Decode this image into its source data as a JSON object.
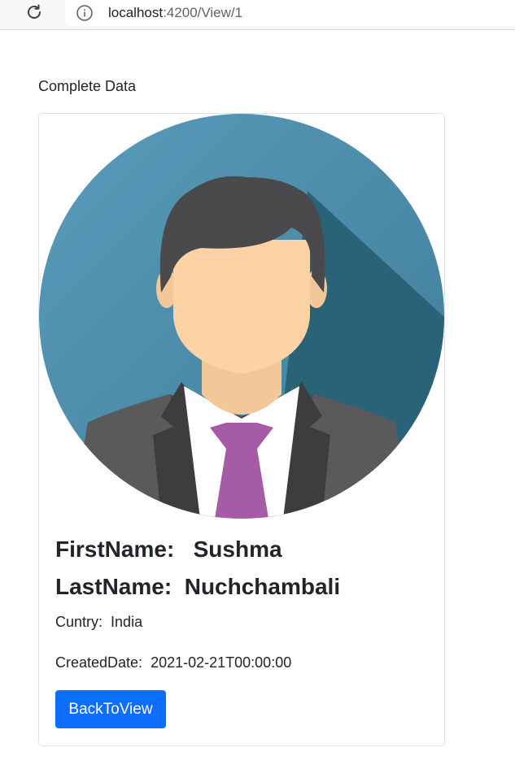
{
  "browser": {
    "url_host": "localhost",
    "url_path": ":4200/View/1"
  },
  "page": {
    "heading": "Complete Data"
  },
  "profile": {
    "first_name_label": "FirstName:",
    "first_name": "Sushma",
    "last_name_label": "LastName:",
    "last_name": "Nuchchambali",
    "country_label": "Cuntry:",
    "country": "India",
    "created_label": "CreatedDate:",
    "created_date": "2021-02-21T00:00:00",
    "back_button_label": "BackToView"
  },
  "colors": {
    "button": "#0d6efd",
    "avatar_bg": "#4a8aa9",
    "tie": "#a55ba5"
  },
  "icons": {
    "reload": "reload-icon",
    "info": "info-icon"
  }
}
